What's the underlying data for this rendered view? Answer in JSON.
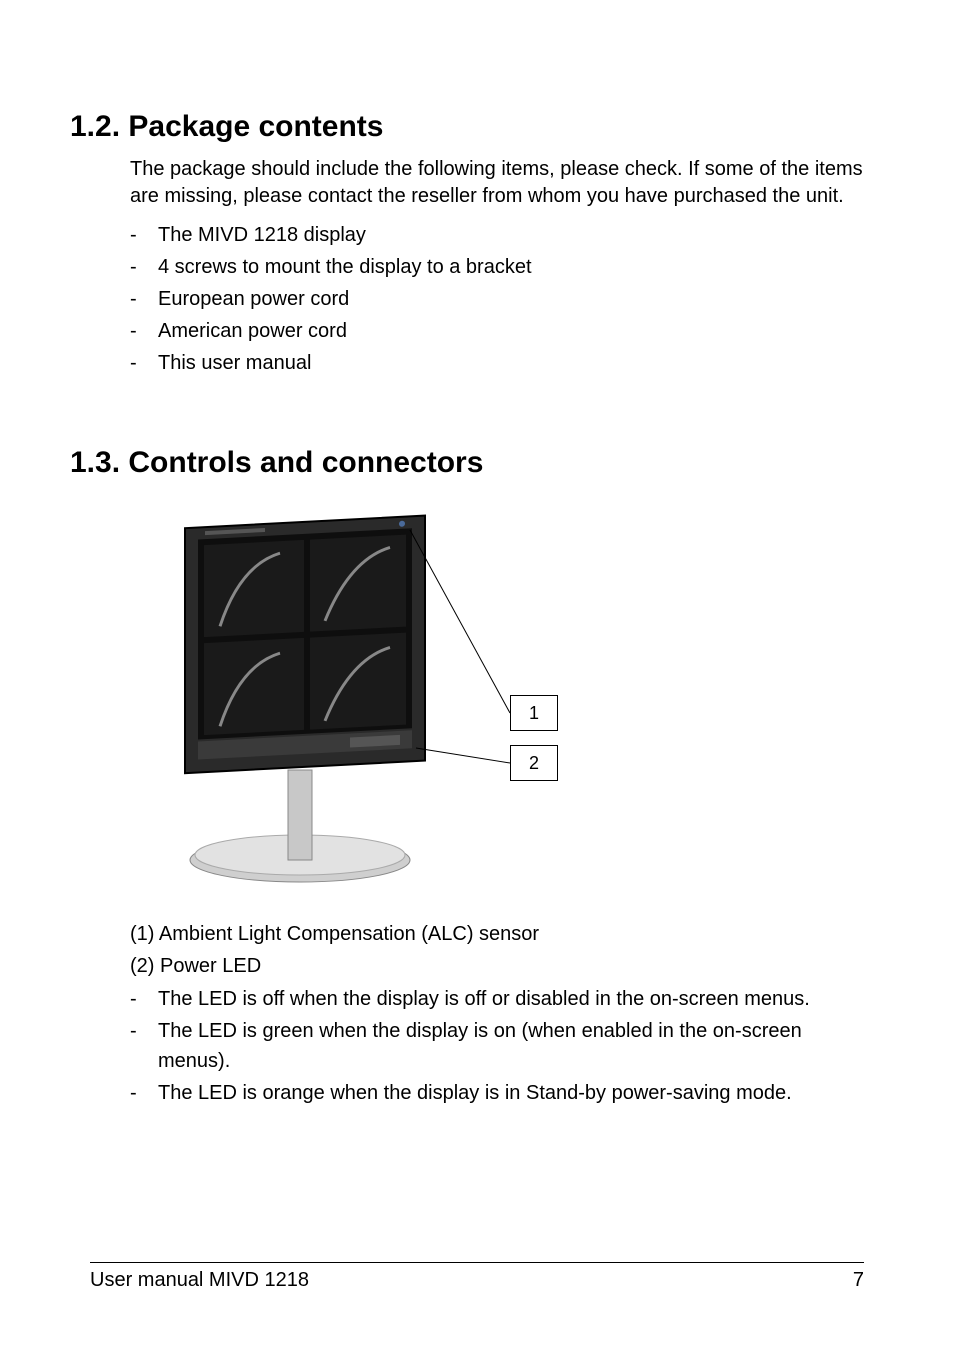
{
  "section12": {
    "heading": "1.2.  Package contents",
    "intro": "The package should include the following items, please check. If some of the items are missing, please contact the reseller from whom you have purchased the unit.",
    "items": [
      "The MIVD 1218 display",
      "4 screws to mount the display to a bracket",
      "European power cord",
      "American power cord",
      "This user manual"
    ]
  },
  "section13": {
    "heading": "1.3.  Controls and connectors",
    "callout1": "1",
    "callout2": "2",
    "numbered": [
      "(1) Ambient Light Compensation (ALC) sensor",
      "(2) Power LED"
    ],
    "ledItems": [
      "The LED is off when the display is off or disabled in the on-screen menus.",
      "The LED is green when the display is on (when enabled in the on-screen menus).",
      "The LED is orange when the display is in Stand-by power-saving mode."
    ]
  },
  "footer": {
    "left": "User manual MIVD 1218",
    "right": "7"
  }
}
